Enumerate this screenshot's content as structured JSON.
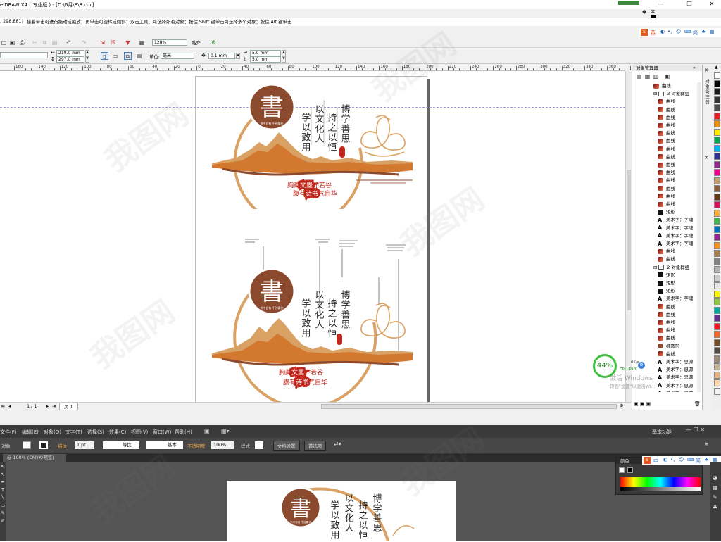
{
  "corel": {
    "title": "elDRAW X4 ( 专业版 ) - [D:\\6月\\8\\8.cdr]",
    "status_coords": ", 298.881)",
    "status_hint": "接着单击可进行拖动或缩放；再单击可旋转或倾斜；双击工具，可选择所有对象；按住 Shift 键单击可选择多个对象；按住 Alt 键单击",
    "ime_label": "英",
    "ime_simp": "简",
    "page_width": "210.0 mm",
    "page_height": "297.0 mm",
    "zoom": "128%",
    "snap_label": "贴齐",
    "unit_label": "单位:",
    "unit_value": "毫米",
    "nudge": "0.1 mm",
    "dup_x": "5.0 mm",
    "dup_y": "5.0 mm",
    "ruler_ticks": [
      "160",
      "140",
      "120",
      "100",
      "80",
      "60",
      "40",
      "20",
      "0",
      "20",
      "40",
      "60",
      "80",
      "100",
      "120",
      "140",
      "160",
      "180",
      "200",
      "220",
      "240",
      "260",
      "280",
      "300",
      "320",
      "340",
      "360",
      "380"
    ],
    "page_counter": "1 / 1",
    "page_tab": "页 1",
    "object_manager": {
      "title": "对象管理器",
      "items": [
        {
          "icon": "curve",
          "label": "曲线",
          "indent": 1
        },
        {
          "icon": "group",
          "label": "3 对象群组",
          "indent": 1
        },
        {
          "icon": "curve",
          "label": "曲线",
          "indent": 2
        },
        {
          "icon": "curve",
          "label": "曲线",
          "indent": 2
        },
        {
          "icon": "curve",
          "label": "曲线",
          "indent": 2
        },
        {
          "icon": "curve",
          "label": "曲线",
          "indent": 2
        },
        {
          "icon": "curve",
          "label": "曲线",
          "indent": 2
        },
        {
          "icon": "curve",
          "label": "曲线",
          "indent": 2
        },
        {
          "icon": "curve",
          "label": "曲线",
          "indent": 2
        },
        {
          "icon": "curve",
          "label": "曲线",
          "indent": 2
        },
        {
          "icon": "curve",
          "label": "曲线",
          "indent": 2
        },
        {
          "icon": "curve",
          "label": "曲线",
          "indent": 2
        },
        {
          "icon": "curve",
          "label": "曲线",
          "indent": 2
        },
        {
          "icon": "curve",
          "label": "曲线",
          "indent": 2
        },
        {
          "icon": "curve",
          "label": "曲线",
          "indent": 2
        },
        {
          "icon": "curve",
          "label": "曲线",
          "indent": 2
        },
        {
          "icon": "rect",
          "label": "矩形",
          "indent": 2
        },
        {
          "icon": "text",
          "label": "美术字：字魂",
          "indent": 2
        },
        {
          "icon": "text",
          "label": "美术字：字魂",
          "indent": 2
        },
        {
          "icon": "text",
          "label": "美术字：字魂",
          "indent": 2
        },
        {
          "icon": "text",
          "label": "美术字：字魂",
          "indent": 2
        },
        {
          "icon": "curve",
          "label": "曲线",
          "indent": 2
        },
        {
          "icon": "curve",
          "label": "曲线",
          "indent": 2
        },
        {
          "icon": "group",
          "label": "2 对象群组",
          "indent": 1
        },
        {
          "icon": "rect",
          "label": "矩形",
          "indent": 2
        },
        {
          "icon": "rect",
          "label": "矩形",
          "indent": 2
        },
        {
          "icon": "rect",
          "label": "矩形",
          "indent": 2
        },
        {
          "icon": "text",
          "label": "美术字：字魂",
          "indent": 2
        },
        {
          "icon": "curve",
          "label": "曲线",
          "indent": 2
        },
        {
          "icon": "curve",
          "label": "曲线",
          "indent": 2
        },
        {
          "icon": "curve",
          "label": "曲线",
          "indent": 2
        },
        {
          "icon": "curve",
          "label": "曲线",
          "indent": 2
        },
        {
          "icon": "curve",
          "label": "曲线",
          "indent": 2
        },
        {
          "icon": "ellipse",
          "label": "椭圆形",
          "indent": 2
        },
        {
          "icon": "curve",
          "label": "曲线",
          "indent": 2
        },
        {
          "icon": "text",
          "label": "美术字：思源",
          "indent": 2
        },
        {
          "icon": "text",
          "label": "美术字：思源",
          "indent": 2
        },
        {
          "icon": "text",
          "label": "美术字：思源",
          "indent": 2
        },
        {
          "icon": "text",
          "label": "美术字：思源",
          "indent": 2
        },
        {
          "icon": "text",
          "label": "美术字：思源",
          "indent": 2
        }
      ]
    },
    "side_tab_label": "对象管理器",
    "palette": [
      "#ffffff",
      "#000000",
      "#1a1a1a",
      "#333333",
      "#4d4d4d",
      "#e31e24",
      "#f08c00",
      "#ffed00",
      "#00a651",
      "#00aeef",
      "#2e3192",
      "#92278f",
      "#ec008c",
      "#c69c6d",
      "#8b5e3c",
      "#603913",
      "#d4145a",
      "#fbb03b",
      "#39b54a",
      "#0071bc",
      "#93278f",
      "#f7931e",
      "#a67c52",
      "#808080",
      "#b3b3b3",
      "#cccccc",
      "#e6e6e6",
      "#fff200",
      "#8dc63f",
      "#00a99d",
      "#662d91",
      "#ed1c24",
      "#f26522",
      "#754c24",
      "#534741",
      "#998675",
      "#c7b299",
      "#e6b07a",
      "#ffd5a8",
      "#f1f2f2"
    ],
    "monitor": {
      "percent": "44%",
      "cpu": "CPU 49℃",
      "net": "0K/s",
      "activate_line1": "激活 Windows",
      "activate_line2": "转到\"设置\"以激活Wi..."
    }
  },
  "artwork": {
    "seal_char": "書",
    "seal_sub": "书中自有 千钟粟也",
    "col1": "博学善思",
    "col2": "持之以恒",
    "col3": "以文化人",
    "col4": "学以致用",
    "stamp": "读书",
    "line1_pre": "胸藏",
    "line1_hl": "文墨",
    "line1_post": "怀若谷",
    "line2_pre": "腹有",
    "line2_hl": "诗书",
    "line2_post": "气自华",
    "brand_color": "#8b4a2e",
    "orange_color": "#d2782f",
    "gold_color": "#d9a264",
    "red_color": "#c0281e"
  },
  "illustrator": {
    "menu": [
      "文件(F)",
      "编辑(E)",
      "对象(O)",
      "文字(T)",
      "选择(S)",
      "效果(C)",
      "视图(V)",
      "窗口(W)",
      "帮助(H)"
    ],
    "workspace": "基本功能",
    "ctrl_object": "对象",
    "ctrl_stroke": "描边",
    "ctrl_stroke_val": "1 pt",
    "ctrl_profile": "等比",
    "ctrl_brush": "基本",
    "ctrl_opacity_label": "不透明度",
    "ctrl_opacity": "100%",
    "ctrl_style": "样式",
    "ctrl_docsetup": "文档设置",
    "ctrl_prefs": "首选项",
    "doc_tab": "@ 100% (CMYK/预览)",
    "color_panel_title": "颜色",
    "ime_label": "中",
    "ime_simp": "简"
  },
  "watermark": "我图网"
}
